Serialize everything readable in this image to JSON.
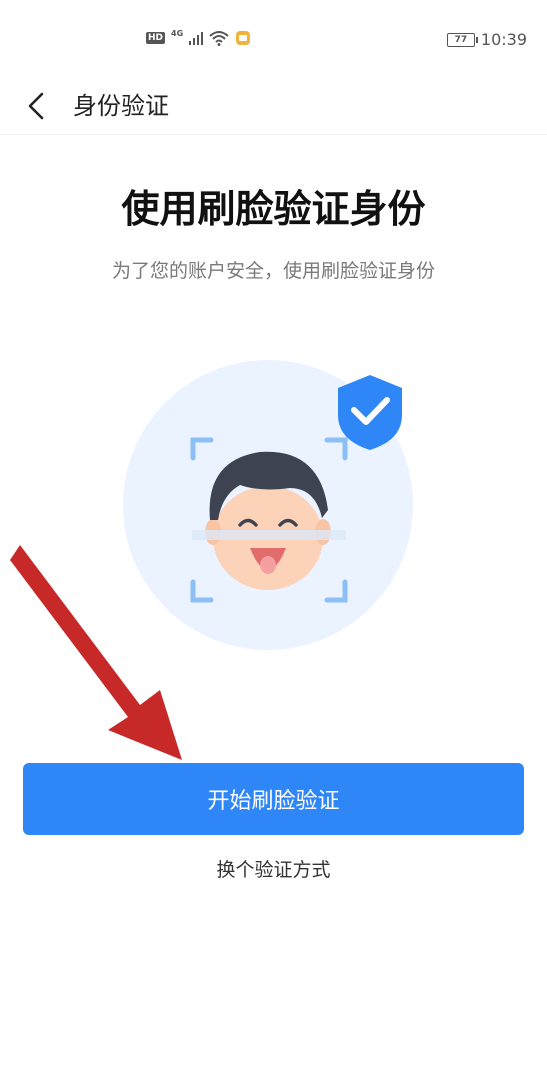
{
  "status_bar": {
    "hd_label": "HD",
    "network_label": "4G",
    "battery_level": "77",
    "time": "10:39"
  },
  "header": {
    "title": "身份验证"
  },
  "main": {
    "title": "使用刷脸验证身份",
    "subtitle": "为了您的账户安全，使用刷脸验证身份"
  },
  "actions": {
    "start_button": "开始刷脸验证",
    "alt_method_link": "换个验证方式"
  },
  "colors": {
    "primary": "#2f86f6",
    "illustration_bg": "#eaf3ff",
    "shield": "#2f86f6",
    "annotation_arrow": "#c41e1e"
  },
  "icons": {
    "back": "chevron-left-icon",
    "shield": "shield-check-icon",
    "face": "face-scan-icon"
  }
}
